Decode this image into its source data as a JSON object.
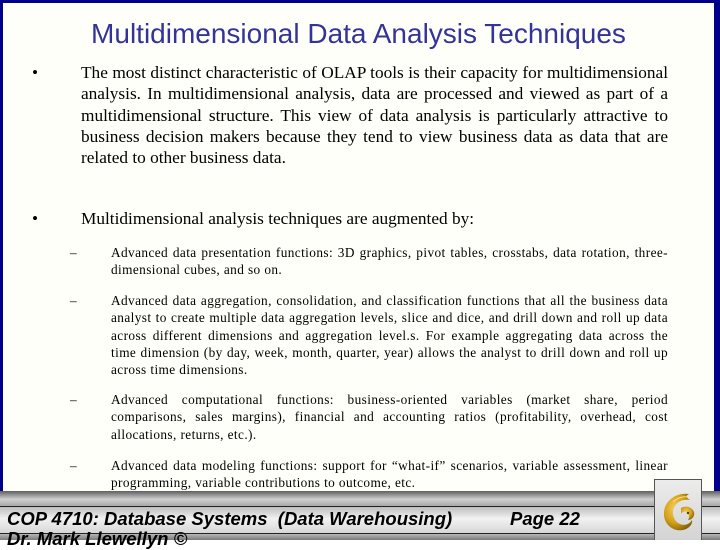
{
  "slide": {
    "title": "Multidimensional Data Analysis Techniques",
    "bullets": [
      {
        "marker": "•",
        "text": "The most distinct characteristic of OLAP tools is their capacity for multidimensional analysis.  In multidimensional analysis, data are processed and viewed as part of a multidimensional structure.  This view of data analysis is particularly attractive to business decision makers because they tend to view business data as data that are related to other business data."
      },
      {
        "marker": "•",
        "text": "Multidimensional analysis techniques are augmented by:"
      }
    ],
    "sub_bullets": [
      {
        "marker": "–",
        "text": "Advanced data presentation functions: 3D graphics, pivot tables, crosstabs, data rotation, three-dimensional cubes, and so on."
      },
      {
        "marker": "–",
        "text": "Advanced data aggregation, consolidation, and classification functions that all the business data analyst to create multiple data aggregation levels, slice and dice, and drill down and roll up data across different dimensions and aggregation level.s.  For example aggregating data across  the time dimension (by day, week, month, quarter, year) allows the analyst to drill down and roll up across time dimensions."
      },
      {
        "marker": "–",
        "text": "Advanced computational functions: business-oriented variables (market share, period comparisons, sales margins), financial and accounting ratios (profitability, overhead, cost allocations, returns, etc.)."
      },
      {
        "marker": "–",
        "text": "Advanced data modeling functions: support for “what-if” scenarios, variable assessment, linear programming, variable contributions to outcome, etc."
      }
    ]
  },
  "footer": {
    "course": "COP 4710: Database Systems  (Data Warehousing)",
    "page": "Page 22",
    "author": "Dr. Mark Llewellyn ©",
    "logo_icon": "ucf-pegasus-logo-icon"
  },
  "colors": {
    "frame": "#00008b",
    "title": "#333399",
    "logo_gold": "#d4a017"
  }
}
